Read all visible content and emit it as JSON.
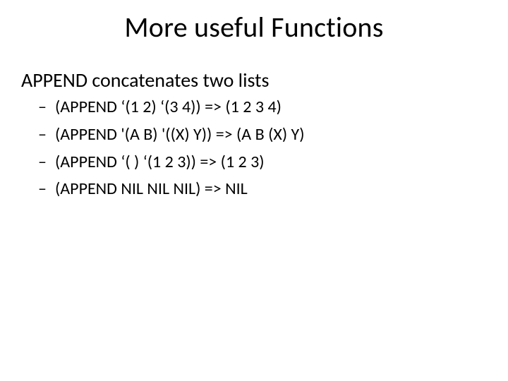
{
  "title": "More useful Functions",
  "lead": "APPEND concatenates two lists",
  "bullets": [
    "(APPEND ‘(1 2) ‘(3 4)) => (1 2 3 4)",
    "(APPEND '(A B) '((X) Y)) => (A B (X) Y)",
    "(APPEND ‘( ) ‘(1 2 3)) => (1 2 3)",
    "(APPEND NIL NIL NIL) => NIL"
  ]
}
